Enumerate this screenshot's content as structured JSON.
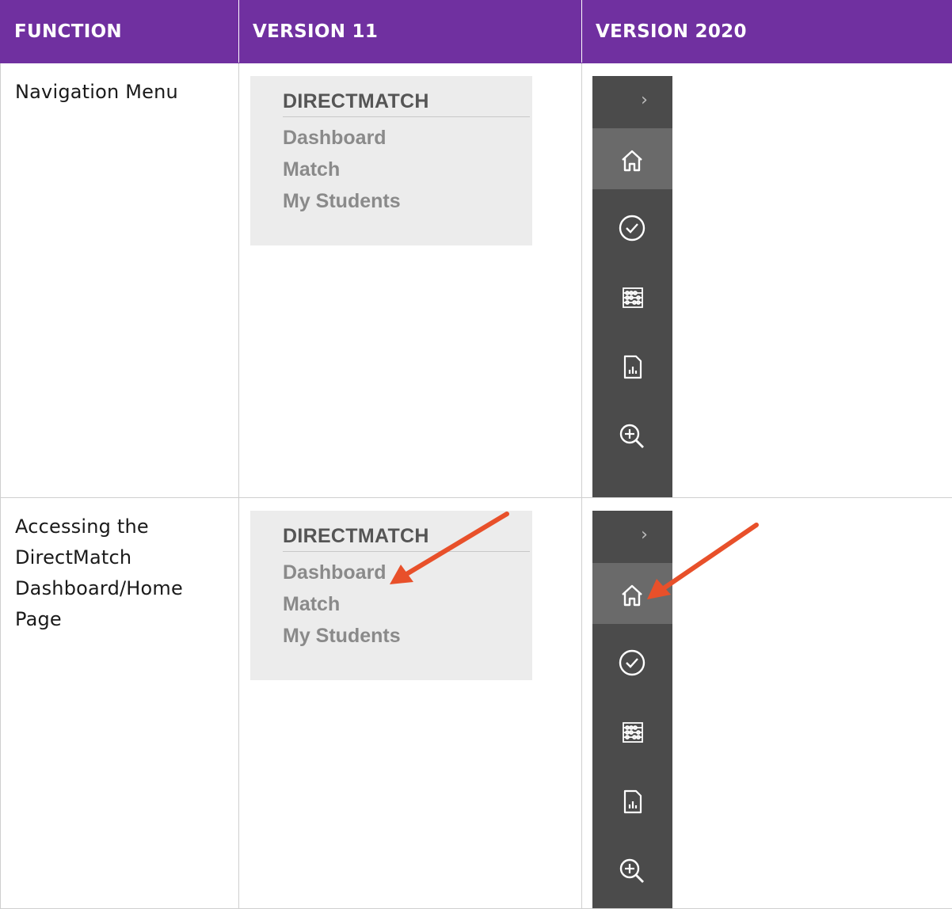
{
  "table": {
    "headers": [
      "FUNCTION",
      "VERSION 11",
      "VERSION 2020"
    ],
    "rows": [
      {
        "function": "Navigation Menu"
      },
      {
        "function": "Accessing the DirectMatch Dashboard/Home Page"
      }
    ]
  },
  "v11_menu": {
    "heading": "DIRECTMATCH",
    "items": [
      "Dashboard",
      "Match",
      "My Students"
    ]
  },
  "v2020_sidebar": {
    "collapse_glyph": "›",
    "icons": [
      "home-icon",
      "checkmark-circle-icon",
      "abacus-icon",
      "report-chart-icon",
      "zoom-in-icon"
    ]
  },
  "colors": {
    "header_bg": "#7030a0",
    "sidebar_bg": "#4b4b4b",
    "sidebar_active": "#6a6a6a",
    "annotation_arrow": "#e8502a",
    "v11_bg": "#ececec"
  }
}
